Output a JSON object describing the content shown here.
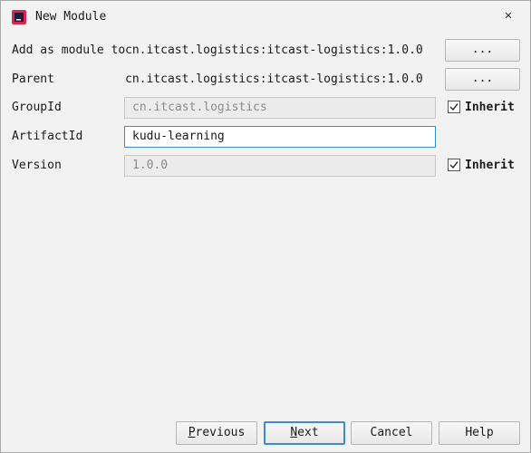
{
  "window": {
    "title": "New Module",
    "close_glyph": "✕"
  },
  "rows": {
    "add_as_module": {
      "label": "Add as module to",
      "value": "cn.itcast.logistics:itcast-logistics:1.0.0",
      "button": "..."
    },
    "parent": {
      "label": "Parent",
      "value": "cn.itcast.logistics:itcast-logistics:1.0.0",
      "button": "..."
    },
    "group_id": {
      "label": "GroupId",
      "value": "cn.itcast.logistics",
      "inherit_label": "Inherit",
      "inherit_checked": true
    },
    "artifact_id": {
      "label": "ArtifactId",
      "value": "kudu-learning"
    },
    "version": {
      "label": "Version",
      "value": "1.0.0",
      "inherit_label": "Inherit",
      "inherit_checked": true
    }
  },
  "buttons": {
    "previous": {
      "mnemonic": "P",
      "rest": "revious"
    },
    "next": {
      "mnemonic": "N",
      "rest": "ext"
    },
    "cancel": "Cancel",
    "help": "Help"
  },
  "colors": {
    "accent": "#3c8ad6",
    "background": "#f2f2f2",
    "disabled_field": "#ececec",
    "icon_red": "#e0234e",
    "icon_dark": "#1b1f3b"
  },
  "icons": {
    "app": "intellij-app-icon",
    "close": "close-icon",
    "check": "checkmark-icon"
  }
}
